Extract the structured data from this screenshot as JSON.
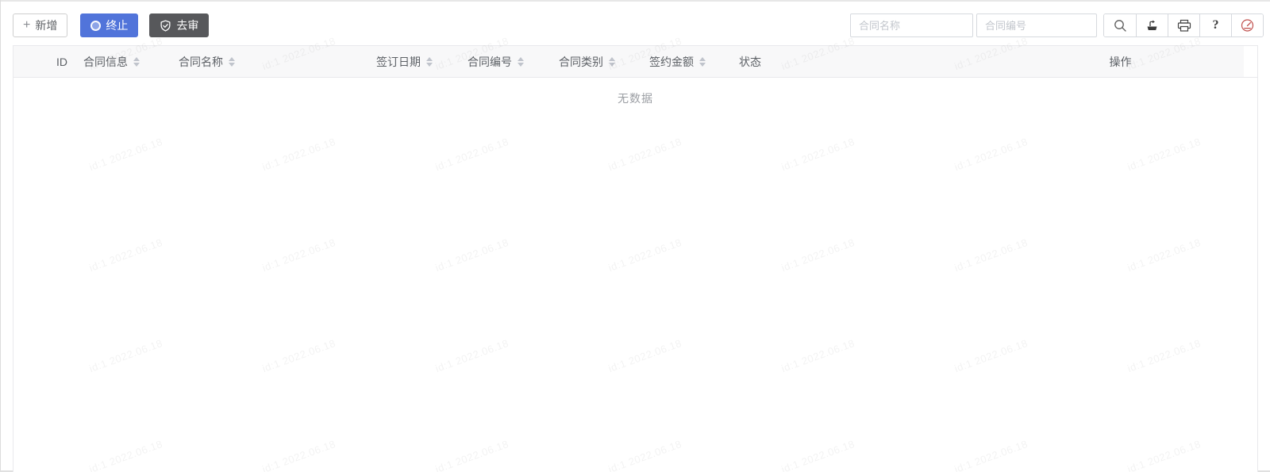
{
  "watermark": {
    "text": "id:1 2022.06.18"
  },
  "toolbar": {
    "add_label": "新增",
    "terminate_label": "终止",
    "review_label": "去审"
  },
  "search": {
    "contract_name_placeholder": "合同名称",
    "contract_code_placeholder": "合同编号",
    "help_label": "?"
  },
  "table": {
    "empty_text": "无数据",
    "columns": [
      {
        "id": "id",
        "label": "ID",
        "sortable": false
      },
      {
        "id": "contract-info",
        "label": "合同信息",
        "sortable": true
      },
      {
        "id": "contract-name",
        "label": "合同名称",
        "sortable": true
      },
      {
        "id": "sign-date",
        "label": "签订日期",
        "sortable": true
      },
      {
        "id": "contract-code",
        "label": "合同编号",
        "sortable": true
      },
      {
        "id": "contract-category",
        "label": "合同类别",
        "sortable": true
      },
      {
        "id": "contract-amount",
        "label": "签约金额",
        "sortable": true
      },
      {
        "id": "status",
        "label": "状态",
        "sortable": false
      },
      {
        "id": "operation",
        "label": "操作",
        "sortable": false
      }
    ]
  },
  "colors": {
    "primary_button": "#5174da",
    "dark_button": "#57585b",
    "header_bg": "#f8f8f9",
    "danger_icon": "#c0504d"
  }
}
